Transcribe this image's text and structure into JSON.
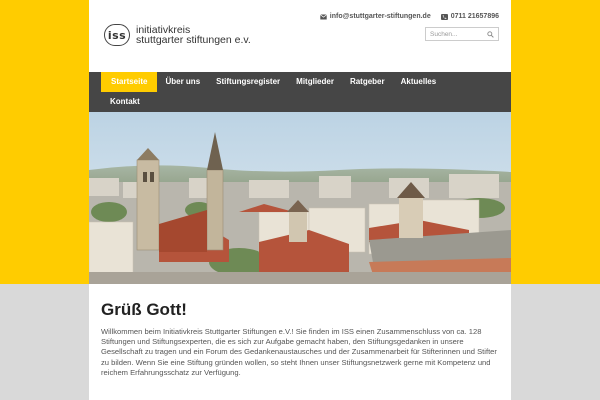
{
  "colors": {
    "accent": "#ffcc00",
    "nav_bg": "#464646",
    "footer_bg": "#d9d9d9"
  },
  "logo": {
    "mark": "iss",
    "line1": "initiativkreis",
    "line2": "stuttgarter stiftungen e.v."
  },
  "contact": {
    "email": "info@stuttgarter-stiftungen.de",
    "email_icon": "envelope-icon",
    "phone": "0711 21657896",
    "phone_icon": "phone-icon"
  },
  "search": {
    "placeholder": "Suchen...",
    "icon": "search-icon"
  },
  "nav": {
    "row1": [
      "Startseite",
      "Über uns",
      "Stiftungsregister",
      "Mitglieder",
      "Ratgeber",
      "Aktuelles"
    ],
    "row2": [
      "Kontakt"
    ],
    "active": "Startseite"
  },
  "hero": {
    "alt": ""
  },
  "main": {
    "title": "Grüß Gott!",
    "intro": "Willkommen beim Initiativkreis Stuttgarter Stiftungen e.V.! Sie finden im ISS einen Zusammenschluss von ca. 128 Stiftungen und Stiftungsexperten, die es sich zur Aufgabe gemacht haben, den Stiftungsgedanken in unsere Gesellschaft zu tragen und ein Forum des Gedankenaustausches und der Zusammenarbeit für Stifterinnen und Stifter zu bilden. Wenn Sie eine Stiftung gründen wollen, so steht Ihnen unser Stiftungsnetzwerk gerne mit Kompetenz und reichem Erfahrungsschatz zur Verfügung."
  }
}
